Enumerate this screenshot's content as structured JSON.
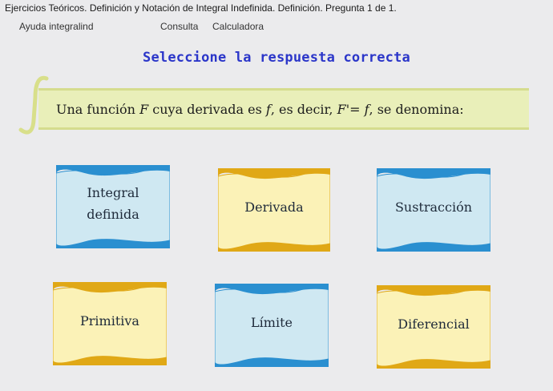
{
  "window": {
    "title": "Ejercicios Teóricos. Definición y Notación de Integral Indefinida. Definición. Pregunta 1 de 1."
  },
  "menu": {
    "items": [
      "Ayuda integralind",
      "Consulta",
      "Calculadora"
    ]
  },
  "heading": "Seleccione la respuesta correcta",
  "question": {
    "part1": "Una función",
    "F": "F",
    "part2": "cuya derivada es",
    "f1": "f",
    "part3": ", es decir,",
    "Fprime": "F'",
    "eq": "=",
    "f2": "f",
    "part4": ", se denomina:"
  },
  "options": [
    {
      "label_lines": [
        "Integral",
        "definida"
      ],
      "style": "blue"
    },
    {
      "label_lines": [
        "Derivada"
      ],
      "style": "yellow"
    },
    {
      "label_lines": [
        "Sustracción"
      ],
      "style": "blue"
    },
    {
      "label_lines": [
        "Primitiva"
      ],
      "style": "yellow"
    },
    {
      "label_lines": [
        "Límite"
      ],
      "style": "blue"
    },
    {
      "label_lines": [
        "Diferencial"
      ],
      "style": "yellow"
    }
  ],
  "colors": {
    "heading": "#2b36c9",
    "question_bg": "#e9efb9",
    "blue_fill": "#cfe8f2",
    "blue_wave": "#2a8fd0",
    "yellow_fill": "#fbf2b7",
    "yellow_wave": "#e0a816"
  }
}
